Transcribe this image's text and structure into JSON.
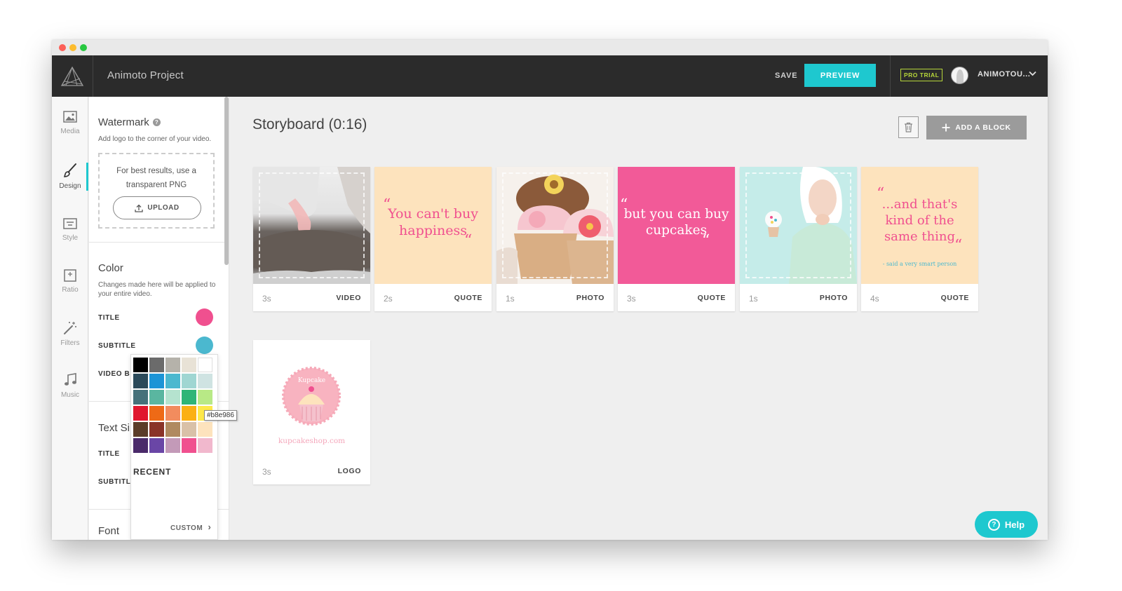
{
  "app": {
    "project_title": "Animoto Project",
    "save_label": "SAVE",
    "preview_label": "PREVIEW",
    "pro_badge": "PRO TRIAL",
    "user_name": "ANIMOTOU...",
    "accent_color": "#1ec8cf"
  },
  "nav": [
    {
      "label": "Media",
      "icon": "image-icon"
    },
    {
      "label": "Design",
      "icon": "brush-icon",
      "active": true
    },
    {
      "label": "Style",
      "icon": "style-icon"
    },
    {
      "label": "Ratio",
      "icon": "ratio-icon"
    },
    {
      "label": "Filters",
      "icon": "magic-wand-icon"
    },
    {
      "label": "Music",
      "icon": "music-note-icon"
    }
  ],
  "panel": {
    "watermark": {
      "title": "Watermark",
      "help_glyph": "?",
      "desc": "Add logo to the corner of your video.",
      "hint": "For best results, use a transparent PNG",
      "upload_label": "UPLOAD"
    },
    "color": {
      "title": "Color",
      "desc": "Changes made here will be applied to your entire video.",
      "rows": [
        {
          "label": "TITLE",
          "color": "#f0508f"
        },
        {
          "label": "SUBTITLE",
          "color": "#4bb8cf"
        },
        {
          "label": "VIDEO B",
          "color": ""
        }
      ]
    },
    "text_size": {
      "title": "Text Si",
      "rows": [
        "TITLE",
        "SUBTITL"
      ]
    },
    "font": {
      "title": "Font"
    }
  },
  "palette": {
    "colors": [
      "#000000",
      "#6b6b6b",
      "#b5b2aa",
      "#e8e2d6",
      "#ffffff",
      "#2b4a5a",
      "#1c94d6",
      "#4bb8cf",
      "#9fd6d2",
      "#cfe3e2",
      "#46717a",
      "#5ab6a0",
      "#b5e3cf",
      "#2fb577",
      "#b8e986",
      "#e0172e",
      "#ee6a16",
      "#f28c5e",
      "#fbb014",
      "#fde84a",
      "#5a3c28",
      "#8a3328",
      "#b08a60",
      "#d9c1a8",
      "#fde3bd",
      "#4a2a6a",
      "#6a46a6",
      "#c39ab8",
      "#f0508f",
      "#f1b8cd"
    ],
    "recent_label": "RECENT",
    "custom_label": "CUSTOM",
    "chevron": "›",
    "hover_hex": "#b8e986"
  },
  "storyboard": {
    "title": "Storyboard (0:16)",
    "add_block_label": "ADD A BLOCK",
    "blocks": [
      {
        "duration": "3s",
        "type": "VIDEO",
        "kind": "video"
      },
      {
        "duration": "2s",
        "type": "QUOTE",
        "kind": "quote",
        "text": "You can't buy happiness",
        "bg": "#fde3bd",
        "fg": "#f0508f"
      },
      {
        "duration": "1s",
        "type": "PHOTO",
        "kind": "photo"
      },
      {
        "duration": "3s",
        "type": "QUOTE",
        "kind": "quote",
        "text": "but you can buy cupcakes",
        "bg": "#f25a98",
        "fg": "#ffffff"
      },
      {
        "duration": "1s",
        "type": "PHOTO",
        "kind": "photo"
      },
      {
        "duration": "4s",
        "type": "QUOTE",
        "kind": "quote",
        "text": "...and that's kind of the same thing",
        "subtext": "- said a very smart person",
        "bg": "#fde3bd",
        "fg": "#f0508f"
      },
      {
        "duration": "3s",
        "type": "LOGO",
        "kind": "logo",
        "logo_text": "Kupcake",
        "logo_url": "kupcakeshop.com"
      }
    ]
  },
  "help_label": "Help",
  "help_glyph": "?"
}
